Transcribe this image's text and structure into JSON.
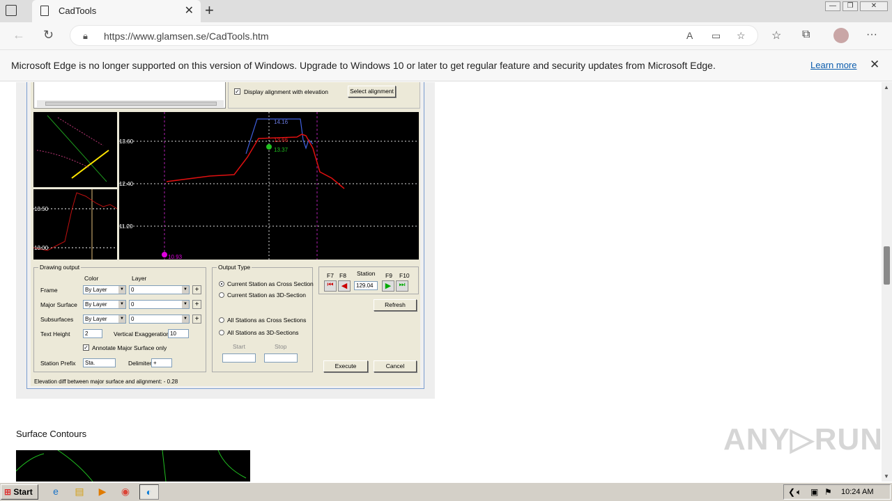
{
  "browser": {
    "tab_title": "CadTools",
    "url": "https://www.glamsen.se/CadTools.htm",
    "window_buttons": [
      "—",
      "❐",
      "✕"
    ]
  },
  "infobar": {
    "message": "Microsoft Edge is no longer supported on this version of Windows. Upgrade to Windows 10 or later to get regular feature and security updates from Microsoft Edge.",
    "link": "Learn more"
  },
  "dialog": {
    "display_alignment_label": "Display alignment with elevation",
    "select_alignment": "Select alignment",
    "main_plot": {
      "labels": [
        "13.60",
        "12.40",
        "11.20"
      ],
      "annotations": [
        "14.16",
        "13.66",
        "13.37",
        "10.93"
      ]
    },
    "profile_plot": {
      "labels": [
        "13.50",
        "13.00"
      ]
    },
    "drawing_output": {
      "title": "Drawing output",
      "col_color": "Color",
      "col_layer": "Layer",
      "rows": [
        {
          "label": "Frame",
          "color": "By Layer",
          "layer": "0"
        },
        {
          "label": "Major Surface",
          "color": "By Layer",
          "layer": "0"
        },
        {
          "label": "Subsurfaces",
          "color": "By Layer",
          "layer": "0"
        }
      ],
      "text_height_label": "Text Height",
      "text_height": "2",
      "vert_exag_label": "Vertical Exaggeration",
      "vert_exag": "10",
      "annotate_label": "Annotate Major Surface only",
      "station_prefix_label": "Station Prefix",
      "station_prefix": "Sta.",
      "delimiter_label": "Delimiter",
      "delimiter": "+"
    },
    "output_type": {
      "title": "Output Type",
      "options": [
        "Current Station as Cross Section",
        "Current Station as 3D-Section",
        "All Stations as Cross Sections",
        "All Stations as 3D-Sections"
      ],
      "selected": 0,
      "start_label": "Start",
      "stop_label": "Stop"
    },
    "station": {
      "keys": [
        "F7",
        "F8",
        "F9",
        "F10"
      ],
      "label": "Station",
      "value": "129.04",
      "refresh": "Refresh"
    },
    "execute": "Execute",
    "cancel": "Cancel",
    "status": "Elevation diff between major surface and alignment: - 0.28"
  },
  "page": {
    "section_heading": "Surface Contours",
    "watermark": "ANY▷RUN"
  },
  "taskbar": {
    "start": "Start",
    "clock": "10:24 AM"
  }
}
